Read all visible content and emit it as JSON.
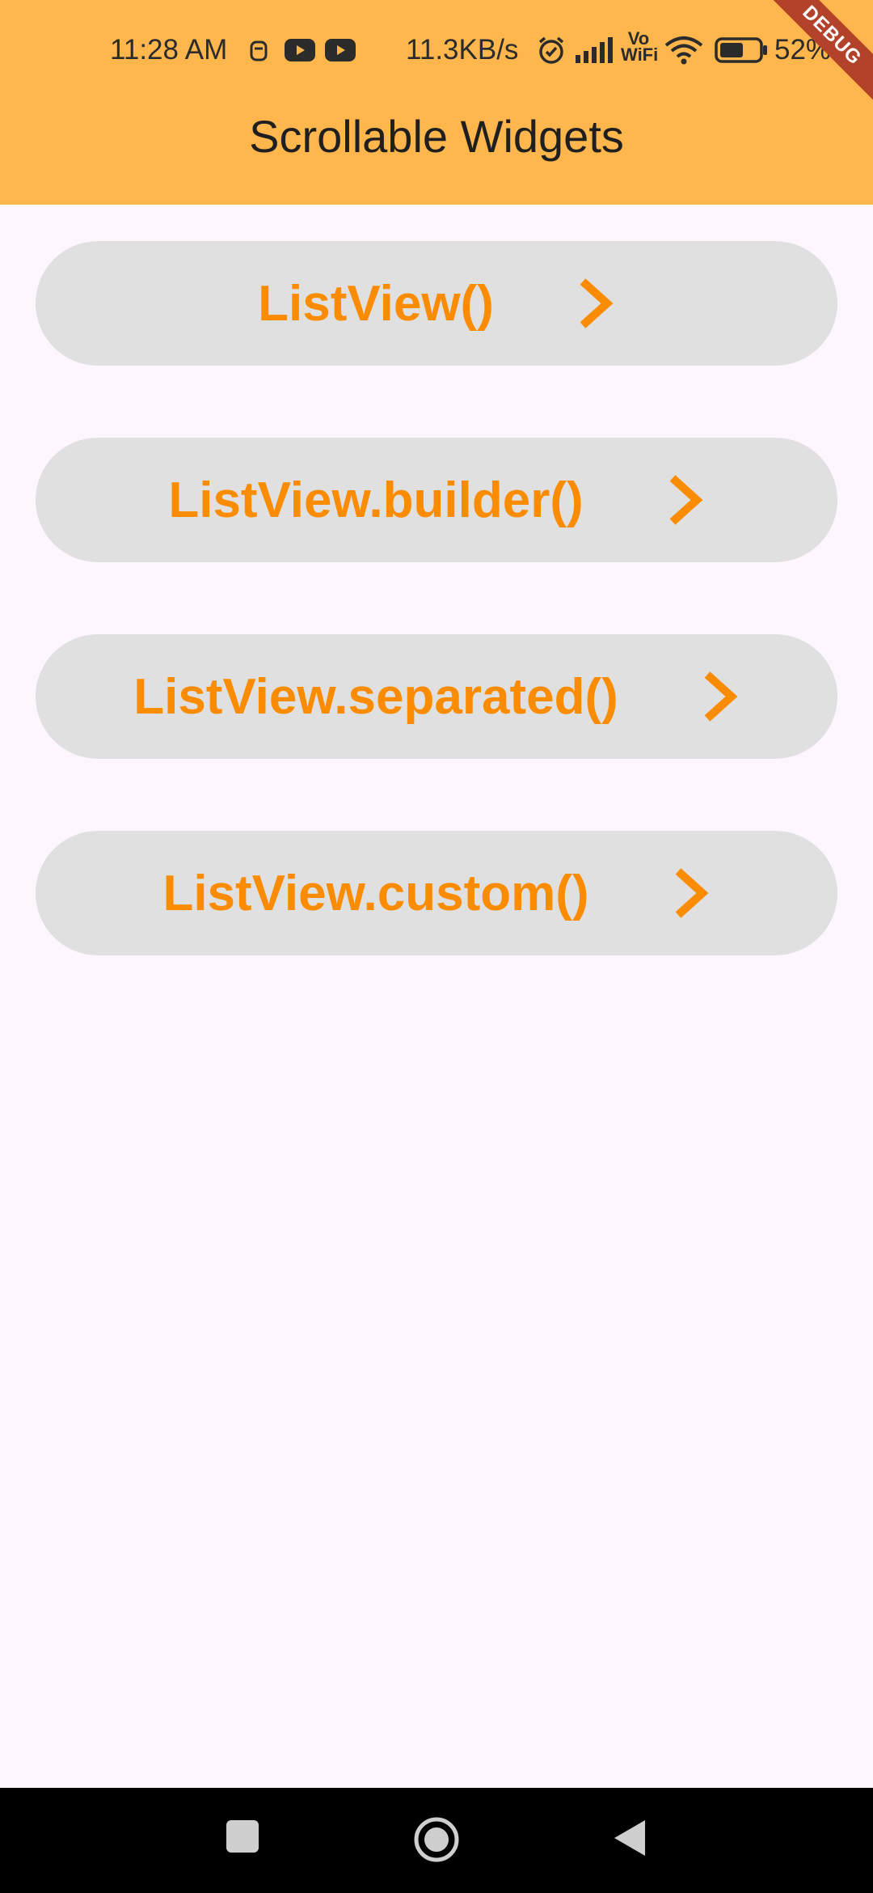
{
  "status_bar": {
    "time": "11:28 AM",
    "net_speed": "11.3KB/s",
    "battery": "52%",
    "icons": [
      "face-icon",
      "youtube-icon",
      "youtube-icon",
      "alarm-icon",
      "signal-icon",
      "vowifi-icon",
      "wifi-icon",
      "battery-icon"
    ],
    "vowifi_label": "Vo WiFi"
  },
  "debug_banner": "DEBUG",
  "app_bar": {
    "title": "Scrollable Widgets",
    "color": "#ffb74d"
  },
  "menu": {
    "items": [
      {
        "label": "ListView()"
      },
      {
        "label": "ListView.builder()"
      },
      {
        "label": "ListView.separated()"
      },
      {
        "label": "ListView.custom()"
      }
    ],
    "accent_color": "#fb8c00",
    "item_background": "#e0e0e0"
  },
  "nav_bar": {
    "buttons": [
      "recents-button",
      "home-button",
      "back-button"
    ]
  }
}
